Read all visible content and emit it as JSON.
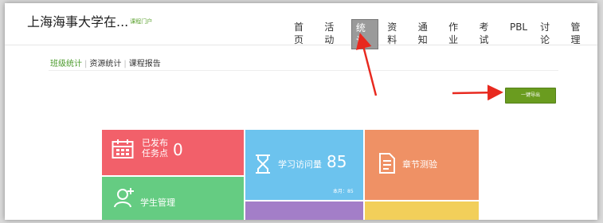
{
  "header": {
    "brand": "上海海事大学在...",
    "brand_sub": "课程门户",
    "nav": [
      "首页",
      "活动",
      "统计",
      "资料",
      "通知",
      "作业",
      "考试",
      "PBL",
      "讨论",
      "管理"
    ],
    "active_nav": "统计"
  },
  "subnav": {
    "items": [
      "班级统计",
      "资源统计",
      "课程报告"
    ],
    "active": "班级统计"
  },
  "export_button": "一键导出",
  "tiles": {
    "published": {
      "label_line1": "已发布",
      "label_line2": "任务点",
      "value": "0",
      "icon": "calendar-icon",
      "color": "#f2606a"
    },
    "visits": {
      "label": "学习访问量",
      "value": "85",
      "sub": "本月：85",
      "icon": "hourglass-icon",
      "color": "#6cc3ee"
    },
    "chapter_quiz": {
      "label": "章节测验",
      "icon": "document-icon",
      "color": "#ef9165"
    },
    "students": {
      "label": "学生管理",
      "icon": "add-user-icon",
      "color": "#65cc82"
    },
    "tile5": {
      "color": "#a37ec8"
    },
    "tile6": {
      "color": "#f2cf5a"
    }
  },
  "annotations": {
    "arrow_color": "#e8291f"
  }
}
